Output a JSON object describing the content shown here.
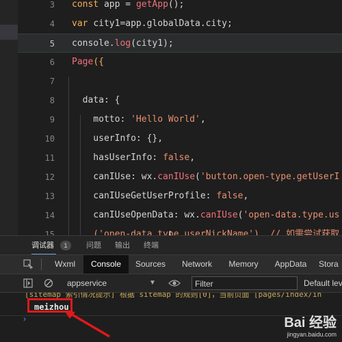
{
  "editor": {
    "lines": [
      {
        "number": "3",
        "text_tokens": [
          {
            "t": "const ",
            "c": "kw"
          },
          {
            "t": "app",
            "c": ""
          },
          {
            "t": " = ",
            "c": ""
          },
          {
            "t": "getApp",
            "c": "fn"
          },
          {
            "t": "();",
            "c": ""
          }
        ]
      },
      {
        "number": "4",
        "text_tokens": [
          {
            "t": "var ",
            "c": "kw"
          },
          {
            "t": "city1=app.globalData.city;",
            "c": ""
          }
        ]
      },
      {
        "number": "5",
        "text_tokens": [
          {
            "t": "console.",
            "c": ""
          },
          {
            "t": "log",
            "c": "fn"
          },
          {
            "t": "(city1);",
            "c": ""
          }
        ]
      },
      {
        "number": "6",
        "text_tokens": [
          {
            "t": "Page",
            "c": "fn"
          },
          {
            "t": "({",
            "c": "kw"
          }
        ]
      },
      {
        "number": "7",
        "text_tokens": []
      },
      {
        "number": "8",
        "text_tokens": [
          {
            "t": "  data: {",
            "c": ""
          }
        ]
      },
      {
        "number": "9",
        "text_tokens": [
          {
            "t": "    motto: ",
            "c": ""
          },
          {
            "t": "'Hello World'",
            "c": "str"
          },
          {
            "t": ",",
            "c": ""
          }
        ]
      },
      {
        "number": "10",
        "text_tokens": [
          {
            "t": "    userInfo: {},",
            "c": ""
          }
        ]
      },
      {
        "number": "11",
        "text_tokens": [
          {
            "t": "    hasUserInfo: ",
            "c": ""
          },
          {
            "t": "false",
            "c": "str"
          },
          {
            "t": ",",
            "c": ""
          }
        ]
      },
      {
        "number": "12",
        "text_tokens": [
          {
            "t": "    canIUse: wx.",
            "c": ""
          },
          {
            "t": "canIUse",
            "c": "fn"
          },
          {
            "t": "(",
            "c": ""
          },
          {
            "t": "'button.open-type.getUserI",
            "c": "str"
          }
        ]
      },
      {
        "number": "13",
        "text_tokens": [
          {
            "t": "    canIUseGetUserProfile: ",
            "c": ""
          },
          {
            "t": "false",
            "c": "str"
          },
          {
            "t": ",",
            "c": ""
          }
        ]
      },
      {
        "number": "14",
        "text_tokens": [
          {
            "t": "    canIUseOpenData: wx.",
            "c": ""
          },
          {
            "t": "canIUse",
            "c": "fn"
          },
          {
            "t": "(",
            "c": ""
          },
          {
            "t": "'open-data.type.us",
            "c": "str"
          }
        ]
      },
      {
        "number": "15",
        "text_tokens": [
          {
            "t": "    ('open-data.type.userNickName')  // 如需尝试获取",
            "c": "str"
          }
        ]
      }
    ]
  },
  "bottom_tabs": {
    "debugger": "调试器",
    "debugger_count": "1",
    "issues": "问题",
    "output": "输出",
    "terminal": "终端"
  },
  "devtools_tabs": [
    "Wxml",
    "Console",
    "Sources",
    "Network",
    "Memory",
    "AppData",
    "Stora"
  ],
  "filter_bar": {
    "context": "appservice",
    "filter_placeholder": "Filter",
    "levels": "Default lev"
  },
  "console": {
    "warning_text": "[sitemap 索引情况提示] 根据 sitemap 的规则[0]，当前页面 [pages/index/in",
    "log_value": "meizhou"
  },
  "watermark": {
    "brand": "Bai 经验",
    "url": "jingyan.baidu.com"
  },
  "colors": {
    "annotation": "#e0191b",
    "active_tab_underline": "#6aa0e6"
  }
}
